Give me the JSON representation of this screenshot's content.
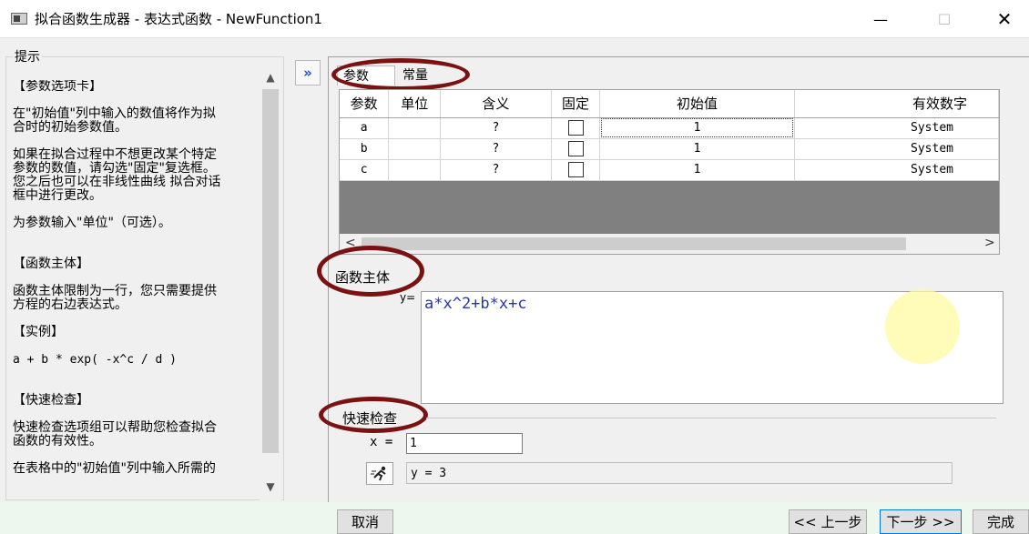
{
  "window": {
    "title": "拟合函数生成器 - 表达式函数 - NewFunction1",
    "minimize": "—",
    "maximize": "☐",
    "close": "✕"
  },
  "hint": {
    "legend": "提示",
    "paragraphs": [
      "【参数选项卡】",
      "在\"初始值\"列中输入的数值将作为拟\n合时的初始参数值。",
      "如果在拟合过程中不想更改某个特定\n参数的数值，请勾选\"固定\"复选框。\n您之后也可以在非线性曲线 拟合对话\n框中进行更改。",
      "为参数输入\"单位\"（可选）。",
      "【函数主体】",
      "函数主体限制为一行，您只需要提供\n方程的右边表达式。",
      "【实例】",
      "a + b * exp( -x^c / d )",
      "【快速检查】",
      "快速检查选项组可以帮助您检查拟合\n函数的有效性。",
      "在表格中的\"初始值\"列中输入所需的"
    ]
  },
  "expand_button": "»",
  "tabs": {
    "params": "参数",
    "constants": "常量"
  },
  "grid": {
    "columns": [
      "参数",
      "单位",
      "含义",
      "固定",
      "初始值",
      "有效数字"
    ],
    "rows": [
      {
        "param": "a",
        "unit": "",
        "meaning": "?",
        "fixed": false,
        "initial": "1",
        "sig": "System"
      },
      {
        "param": "b",
        "unit": "",
        "meaning": "?",
        "fixed": false,
        "initial": "1",
        "sig": "System"
      },
      {
        "param": "c",
        "unit": "",
        "meaning": "?",
        "fixed": false,
        "initial": "1",
        "sig": "System"
      }
    ]
  },
  "function_body": {
    "label": "函数主体",
    "y_label": "y=",
    "expression": "a*x^2+b*x+c"
  },
  "quick_check": {
    "label": "快速检查",
    "x_label": "x =",
    "x_value": "1",
    "result": "y = 3"
  },
  "buttons": {
    "cancel": "取消",
    "prev": "<< 上一步",
    "next": "下一步 >>",
    "finish": "完成"
  },
  "colors": {
    "annotation_circle": "#7b1212",
    "expression_text": "#2a36a8",
    "expand_arrow": "#1e4fd8"
  }
}
